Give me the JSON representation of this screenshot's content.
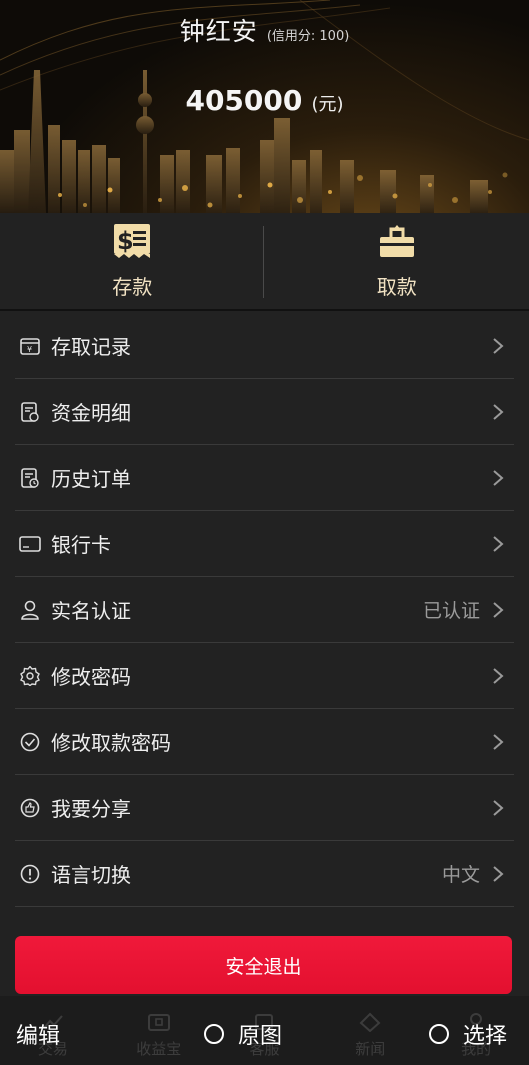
{
  "header": {
    "user_name": "钟红安",
    "credit_text": "(信用分: 100)",
    "balance": "405000",
    "unit": "(元)"
  },
  "actions": [
    {
      "label": "存款",
      "icon": "deposit-icon"
    },
    {
      "label": "取款",
      "icon": "withdraw-icon"
    }
  ],
  "menu": [
    {
      "label": "存取记录",
      "value": "",
      "icon": "record-icon"
    },
    {
      "label": "资金明细",
      "value": "",
      "icon": "fund-detail-icon"
    },
    {
      "label": "历史订单",
      "value": "",
      "icon": "history-order-icon"
    },
    {
      "label": "银行卡",
      "value": "",
      "icon": "bank-card-icon"
    },
    {
      "label": "实名认证",
      "value": "已认证",
      "icon": "user-icon"
    },
    {
      "label": "修改密码",
      "value": "",
      "icon": "gear-icon"
    },
    {
      "label": "修改取款密码",
      "value": "",
      "icon": "check-circle-icon"
    },
    {
      "label": "我要分享",
      "value": "",
      "icon": "thumbs-up-icon"
    },
    {
      "label": "语言切换",
      "value": "中文",
      "icon": "info-circle-icon"
    }
  ],
  "logout_label": "安全退出",
  "tabbar": [
    {
      "label": "交易"
    },
    {
      "label": "收益宝"
    },
    {
      "label": "客服"
    },
    {
      "label": "新闻"
    },
    {
      "label": "我的"
    }
  ],
  "overlay": {
    "edit_label": "编辑",
    "original_label": "原图",
    "select_label": "选择"
  },
  "colors": {
    "background": "#222222",
    "accent_gold": "#f1e2c3",
    "logout_red": "#e3102f",
    "value_gray": "#9a9a9a"
  }
}
